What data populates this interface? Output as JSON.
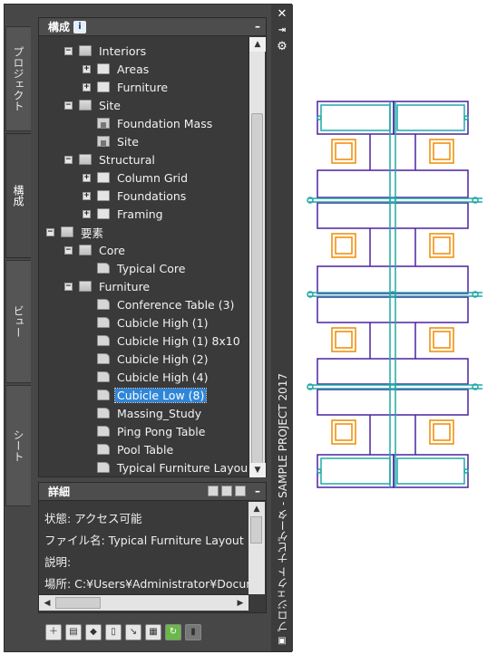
{
  "tabs": [
    {
      "label": "プロジェクト"
    },
    {
      "label": "構成"
    },
    {
      "label": "ビュー"
    },
    {
      "label": "シート"
    }
  ],
  "window_title": "プロジェクト ナビゲータ - SAMPLE PROJECT 2017",
  "structure_panel": {
    "title": "構成",
    "badge": "i",
    "tree": [
      {
        "label": "Interiors",
        "icon": "folder-open-icon",
        "expander": "minus"
      },
      {
        "label": "Areas",
        "icon": "folder-icon",
        "expander": "plus"
      },
      {
        "label": "Furniture",
        "icon": "folder-icon",
        "expander": "plus"
      },
      {
        "label": "Site",
        "icon": "folder-open-icon",
        "expander": "minus"
      },
      {
        "label": "Foundation Mass",
        "icon": "construct-icon",
        "expander": ""
      },
      {
        "label": "Site",
        "icon": "construct-icon",
        "expander": ""
      },
      {
        "label": "Structural",
        "icon": "folder-open-icon",
        "expander": "minus"
      },
      {
        "label": "Column Grid",
        "icon": "folder-icon",
        "expander": "plus"
      },
      {
        "label": "Foundations",
        "icon": "folder-icon",
        "expander": "plus"
      },
      {
        "label": "Framing",
        "icon": "folder-icon",
        "expander": "plus"
      },
      {
        "label": "要素",
        "icon": "folder-open-icon",
        "expander": "minus"
      },
      {
        "label": "Core",
        "icon": "folder-open-icon",
        "expander": "minus"
      },
      {
        "label": "Typical Core",
        "icon": "element-icon",
        "expander": ""
      },
      {
        "label": "Furniture",
        "icon": "folder-open-icon",
        "expander": "minus"
      },
      {
        "label": "Conference Table (3)",
        "icon": "element-icon",
        "expander": ""
      },
      {
        "label": "Cubicle High (1)",
        "icon": "element-icon",
        "expander": ""
      },
      {
        "label": "Cubicle High (1) 8x10",
        "icon": "element-icon",
        "expander": ""
      },
      {
        "label": "Cubicle High (2)",
        "icon": "element-icon",
        "expander": ""
      },
      {
        "label": "Cubicle High (4)",
        "icon": "element-icon",
        "expander": ""
      },
      {
        "label": "Cubicle Low (8)",
        "icon": "element-icon",
        "expander": "",
        "selected": true
      },
      {
        "label": "Massing_Study",
        "icon": "element-icon",
        "expander": ""
      },
      {
        "label": "Ping Pong Table",
        "icon": "element-icon",
        "expander": ""
      },
      {
        "label": "Pool Table",
        "icon": "element-icon",
        "expander": ""
      },
      {
        "label": "Typical Furniture Layout",
        "icon": "element-icon",
        "expander": ""
      }
    ]
  },
  "detail_panel": {
    "title": "詳細",
    "lines": [
      "状態: アクセス可能",
      "ファイル名: Typical Furniture Layout",
      "説明:",
      "場所: C:¥Users¥Administrator¥Docum"
    ]
  },
  "colors": {
    "panel_bg": "#3a3a3a",
    "selected": "#2f86d8",
    "drawing_purple": "#4b22a0",
    "drawing_cyan": "#20a8a8",
    "drawing_orange": "#f08a00"
  }
}
